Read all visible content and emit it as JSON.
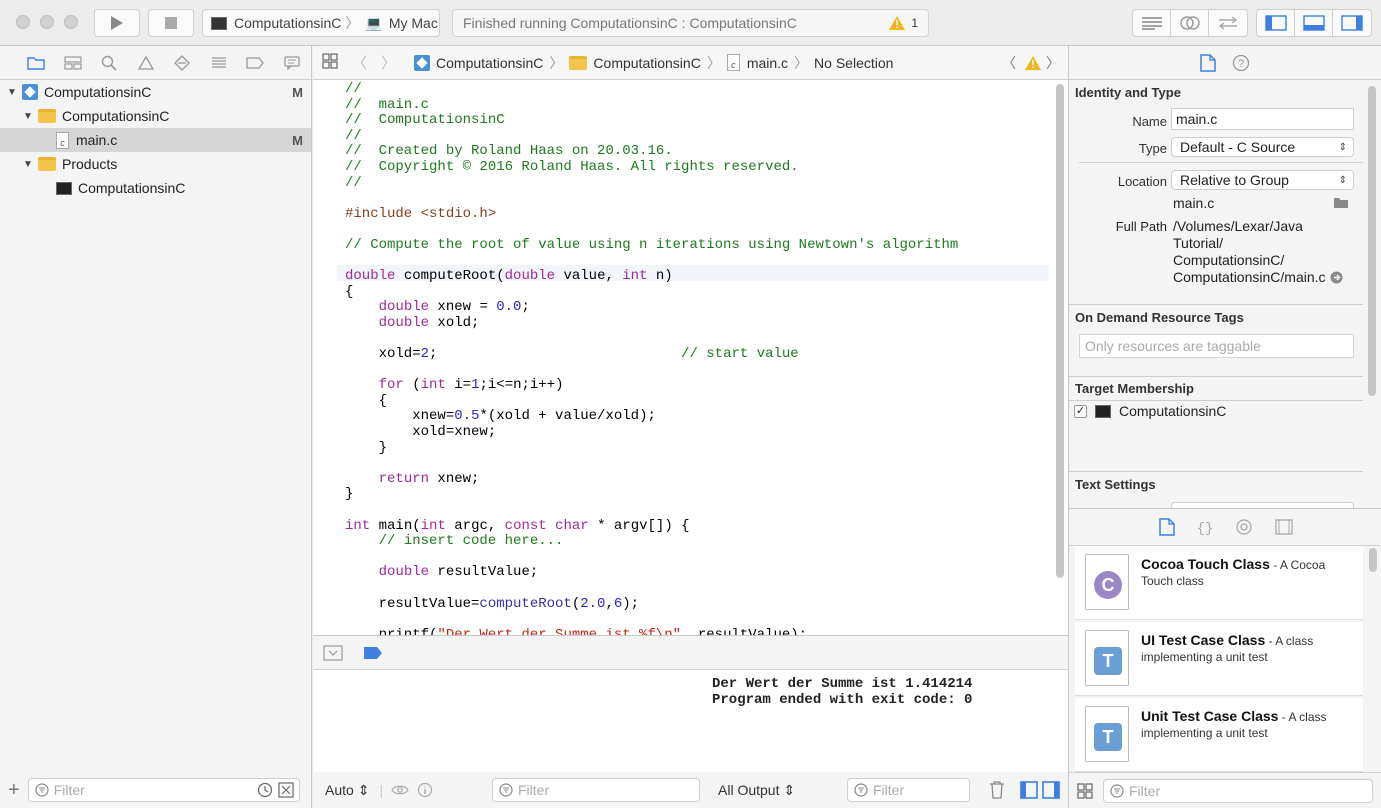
{
  "toolbar": {
    "scheme_target": "ComputationsinC",
    "scheme_device": "My Mac",
    "status_text": "Finished running ComputationsinC : ComputationsinC",
    "warning_count": "1"
  },
  "navigator": {
    "project_name": "ComputationsinC",
    "project_badge": "M",
    "group_name": "ComputationsinC",
    "file_name": "main.c",
    "file_icon_letter": "c",
    "file_badge": "M",
    "products_group": "Products",
    "product_name": "ComputationsinC",
    "filter_placeholder": "Filter"
  },
  "jumpbar": {
    "project": "ComputationsinC",
    "group": "ComputationsinC",
    "file": "main.c",
    "selection": "No Selection"
  },
  "editor": {
    "code_lines": [
      [
        {
          "t": "//",
          "c": "com"
        }
      ],
      [
        {
          "t": "//  main.c",
          "c": "com"
        }
      ],
      [
        {
          "t": "//  ComputationsinC",
          "c": "com"
        }
      ],
      [
        {
          "t": "//",
          "c": "com"
        }
      ],
      [
        {
          "t": "//  Created by Roland Haas on 20.03.16.",
          "c": "com"
        }
      ],
      [
        {
          "t": "//  Copyright © 2016 Roland Haas. All rights reserved.",
          "c": "com"
        }
      ],
      [
        {
          "t": "//",
          "c": "com"
        }
      ],
      [],
      [
        {
          "t": "#include <stdio.h>",
          "c": "pp"
        }
      ],
      [],
      [
        {
          "t": "// Compute the root of value using n iterations using Newtown's algorithm",
          "c": "com"
        }
      ],
      [],
      [
        {
          "t": "double",
          "c": "kw"
        },
        {
          "t": " computeRoot("
        },
        {
          "t": "double",
          "c": "kw"
        },
        {
          "t": " value, "
        },
        {
          "t": "int",
          "c": "kw"
        },
        {
          "t": " n)"
        }
      ],
      [
        {
          "t": "{"
        }
      ],
      [
        {
          "t": "    "
        },
        {
          "t": "double",
          "c": "kw"
        },
        {
          "t": " xnew = "
        },
        {
          "t": "0.0",
          "c": "num"
        },
        {
          "t": ";"
        }
      ],
      [
        {
          "t": "    "
        },
        {
          "t": "double",
          "c": "kw"
        },
        {
          "t": " xold;"
        }
      ],
      [],
      [
        {
          "t": "    xold="
        },
        {
          "t": "2",
          "c": "num"
        },
        {
          "t": ";                             "
        },
        {
          "t": "// start value",
          "c": "com"
        }
      ],
      [],
      [
        {
          "t": "    "
        },
        {
          "t": "for",
          "c": "kw"
        },
        {
          "t": " ("
        },
        {
          "t": "int",
          "c": "kw"
        },
        {
          "t": " i="
        },
        {
          "t": "1",
          "c": "num"
        },
        {
          "t": ";i<=n;i++)"
        }
      ],
      [
        {
          "t": "    {"
        }
      ],
      [
        {
          "t": "        xnew="
        },
        {
          "t": "0.5",
          "c": "num"
        },
        {
          "t": "*(xold + value/xold);"
        }
      ],
      [
        {
          "t": "        xold=xnew;"
        }
      ],
      [
        {
          "t": "    }"
        }
      ],
      [],
      [
        {
          "t": "    "
        },
        {
          "t": "return",
          "c": "kw"
        },
        {
          "t": " xnew;"
        }
      ],
      [
        {
          "t": "}"
        }
      ],
      [],
      [
        {
          "t": "int",
          "c": "kw"
        },
        {
          "t": " main("
        },
        {
          "t": "int",
          "c": "kw"
        },
        {
          "t": " argc, "
        },
        {
          "t": "const",
          "c": "kw"
        },
        {
          "t": " "
        },
        {
          "t": "char",
          "c": "kw"
        },
        {
          "t": " * argv[]) {"
        }
      ],
      [
        {
          "t": "    "
        },
        {
          "t": "// insert code here...",
          "c": "com"
        }
      ],
      [],
      [
        {
          "t": "    "
        },
        {
          "t": "double",
          "c": "kw"
        },
        {
          "t": " resultValue;"
        }
      ],
      [],
      [
        {
          "t": "    resultValue="
        },
        {
          "t": "computeRoot",
          "c": "fn"
        },
        {
          "t": "("
        },
        {
          "t": "2.0",
          "c": "num"
        },
        {
          "t": ","
        },
        {
          "t": "6",
          "c": "num"
        },
        {
          "t": ");"
        }
      ],
      [],
      [
        {
          "t": "    printf("
        },
        {
          "t": "\"Der Wert der Summe ist %f\\n\"",
          "c": "str"
        },
        {
          "t": ", resultValue);"
        }
      ]
    ]
  },
  "debug": {
    "console_output": "Der Wert der Summe ist 1.414214\nProgram ended with exit code: 0",
    "auto_label": "Auto",
    "variables_filter_placeholder": "Filter",
    "output_selector": "All Output",
    "console_filter_placeholder": "Filter"
  },
  "inspector": {
    "identity_title": "Identity and Type",
    "name_label": "Name",
    "name_value": "main.c",
    "type_label": "Type",
    "type_value": "Default - C Source",
    "location_label": "Location",
    "location_value": "Relative to Group",
    "location_file": "main.c",
    "full_path_label": "Full Path",
    "full_path_lines": [
      "/Volumes/Lexar/Java",
      "Tutorial/",
      "ComputationsinC/",
      "ComputationsinC/main.c"
    ],
    "odr_title": "On Demand Resource Tags",
    "odr_placeholder": "Only resources are taggable",
    "target_title": "Target Membership",
    "target_name": "ComputationsinC",
    "text_settings_title": "Text Settings",
    "library_filter_placeholder": "Filter",
    "library_items": [
      {
        "title": "Cocoa Touch Class",
        "desc_line1": " - A Cocoa",
        "desc_line2": "Touch class",
        "letter": "C",
        "color": "#9b87c6"
      },
      {
        "title": "UI Test Case Class",
        "desc_line1": " - A class",
        "desc_line2": "implementing a unit test",
        "letter": "T",
        "color": "#6a9fd6"
      },
      {
        "title": "Unit Test Case Class",
        "desc_line1": " - A class",
        "desc_line2": "implementing a unit test",
        "letter": "T",
        "color": "#6a9fd6"
      }
    ]
  }
}
